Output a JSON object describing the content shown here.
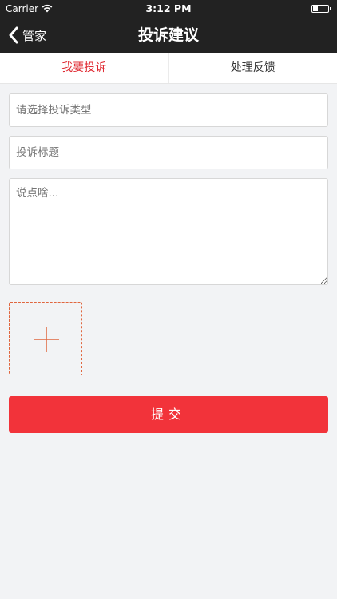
{
  "status_bar": {
    "carrier": "Carrier",
    "time": "3:12 PM",
    "icons": [
      "wifi-icon",
      "battery-icon"
    ]
  },
  "nav": {
    "back_label": "管家",
    "back_icon": "chevron-left-icon",
    "title": "投诉建议"
  },
  "tabs": [
    {
      "label": "我要投诉",
      "active": true
    },
    {
      "label": "处理反馈",
      "active": false
    }
  ],
  "form": {
    "type_placeholder": "请选择投诉类型",
    "title_placeholder": "投诉标题",
    "content_placeholder": "说点啥...",
    "upload_icon": "plus-icon"
  },
  "submit_label": "提交",
  "colors": {
    "accent": "#e02b33",
    "button": "#f2333a",
    "upload_border": "#e0663e",
    "header": "#222222"
  }
}
